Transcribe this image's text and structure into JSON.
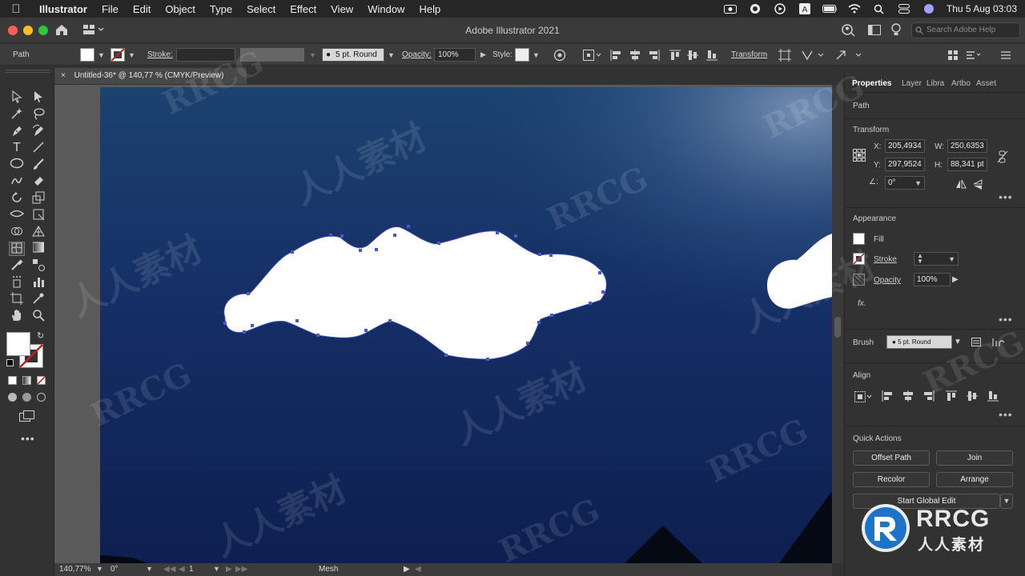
{
  "menubar": {
    "app_name": "Illustrator",
    "items": [
      "File",
      "Edit",
      "Object",
      "Type",
      "Select",
      "Effect",
      "View",
      "Window",
      "Help"
    ],
    "clock": "Thu 5 Aug  03:03"
  },
  "window": {
    "title": "Adobe Illustrator 2021",
    "search_placeholder": "Search Adobe Help"
  },
  "controlbar": {
    "selection_type": "Path",
    "stroke_label": "Stroke:",
    "brush_value": "5 pt. Round",
    "opacity_label": "Opacity:",
    "opacity_value": "100%",
    "style_label": "Style:",
    "transform_label": "Transform"
  },
  "document": {
    "tab_title": "Untitled-36* @ 140,77 % (CMYK/Preview)"
  },
  "statusbar": {
    "zoom": "140,77%",
    "rotation": "0°",
    "artboard_number": "1",
    "tool_name": "Mesh"
  },
  "panel": {
    "tabs": [
      "Properties",
      "Layer",
      "Libra",
      "Artbo",
      "Asset"
    ],
    "object_type": "Path",
    "transform": {
      "heading": "Transform",
      "x_label": "X:",
      "x_value": "205,4934",
      "y_label": "Y:",
      "y_value": "297,9524",
      "w_label": "W:",
      "w_value": "250,6353",
      "h_label": "H:",
      "h_value": "88,341 pt",
      "angle_value": "0°"
    },
    "appearance": {
      "heading": "Appearance",
      "fill_label": "Fill",
      "stroke_label": "Stroke",
      "opacity_label": "Opacity",
      "opacity_value": "100%",
      "fx_label": "fx."
    },
    "brush": {
      "label": "Brush",
      "value": "5 pt. Round"
    },
    "align": {
      "heading": "Align"
    },
    "quick_actions": {
      "heading": "Quick Actions",
      "offset_path": "Offset Path",
      "join": "Join",
      "recolor": "Recolor",
      "arrange": "Arrange",
      "start_global_edit": "Start Global Edit"
    }
  },
  "watermark": {
    "latin": "RRCG",
    "cjk": "人人素材"
  },
  "colors": {
    "sky_top": "#1b3f73",
    "sky_bottom": "#0f2252",
    "glow": "#6d89b0",
    "selection": "#4c55d6",
    "stroke_none": "#c02020"
  }
}
